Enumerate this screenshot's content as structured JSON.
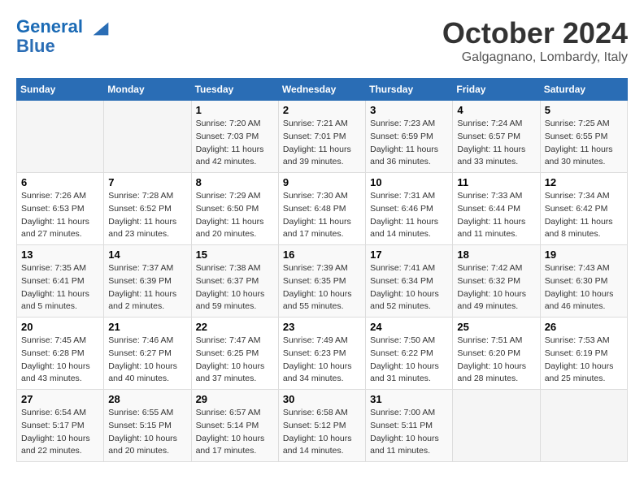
{
  "header": {
    "logo_line1": "General",
    "logo_line2": "Blue",
    "month": "October 2024",
    "location": "Galgagnano, Lombardy, Italy"
  },
  "weekdays": [
    "Sunday",
    "Monday",
    "Tuesday",
    "Wednesday",
    "Thursday",
    "Friday",
    "Saturday"
  ],
  "weeks": [
    [
      {
        "day": "",
        "info": ""
      },
      {
        "day": "",
        "info": ""
      },
      {
        "day": "1",
        "info": "Sunrise: 7:20 AM\nSunset: 7:03 PM\nDaylight: 11 hours and 42 minutes."
      },
      {
        "day": "2",
        "info": "Sunrise: 7:21 AM\nSunset: 7:01 PM\nDaylight: 11 hours and 39 minutes."
      },
      {
        "day": "3",
        "info": "Sunrise: 7:23 AM\nSunset: 6:59 PM\nDaylight: 11 hours and 36 minutes."
      },
      {
        "day": "4",
        "info": "Sunrise: 7:24 AM\nSunset: 6:57 PM\nDaylight: 11 hours and 33 minutes."
      },
      {
        "day": "5",
        "info": "Sunrise: 7:25 AM\nSunset: 6:55 PM\nDaylight: 11 hours and 30 minutes."
      }
    ],
    [
      {
        "day": "6",
        "info": "Sunrise: 7:26 AM\nSunset: 6:53 PM\nDaylight: 11 hours and 27 minutes."
      },
      {
        "day": "7",
        "info": "Sunrise: 7:28 AM\nSunset: 6:52 PM\nDaylight: 11 hours and 23 minutes."
      },
      {
        "day": "8",
        "info": "Sunrise: 7:29 AM\nSunset: 6:50 PM\nDaylight: 11 hours and 20 minutes."
      },
      {
        "day": "9",
        "info": "Sunrise: 7:30 AM\nSunset: 6:48 PM\nDaylight: 11 hours and 17 minutes."
      },
      {
        "day": "10",
        "info": "Sunrise: 7:31 AM\nSunset: 6:46 PM\nDaylight: 11 hours and 14 minutes."
      },
      {
        "day": "11",
        "info": "Sunrise: 7:33 AM\nSunset: 6:44 PM\nDaylight: 11 hours and 11 minutes."
      },
      {
        "day": "12",
        "info": "Sunrise: 7:34 AM\nSunset: 6:42 PM\nDaylight: 11 hours and 8 minutes."
      }
    ],
    [
      {
        "day": "13",
        "info": "Sunrise: 7:35 AM\nSunset: 6:41 PM\nDaylight: 11 hours and 5 minutes."
      },
      {
        "day": "14",
        "info": "Sunrise: 7:37 AM\nSunset: 6:39 PM\nDaylight: 11 hours and 2 minutes."
      },
      {
        "day": "15",
        "info": "Sunrise: 7:38 AM\nSunset: 6:37 PM\nDaylight: 10 hours and 59 minutes."
      },
      {
        "day": "16",
        "info": "Sunrise: 7:39 AM\nSunset: 6:35 PM\nDaylight: 10 hours and 55 minutes."
      },
      {
        "day": "17",
        "info": "Sunrise: 7:41 AM\nSunset: 6:34 PM\nDaylight: 10 hours and 52 minutes."
      },
      {
        "day": "18",
        "info": "Sunrise: 7:42 AM\nSunset: 6:32 PM\nDaylight: 10 hours and 49 minutes."
      },
      {
        "day": "19",
        "info": "Sunrise: 7:43 AM\nSunset: 6:30 PM\nDaylight: 10 hours and 46 minutes."
      }
    ],
    [
      {
        "day": "20",
        "info": "Sunrise: 7:45 AM\nSunset: 6:28 PM\nDaylight: 10 hours and 43 minutes."
      },
      {
        "day": "21",
        "info": "Sunrise: 7:46 AM\nSunset: 6:27 PM\nDaylight: 10 hours and 40 minutes."
      },
      {
        "day": "22",
        "info": "Sunrise: 7:47 AM\nSunset: 6:25 PM\nDaylight: 10 hours and 37 minutes."
      },
      {
        "day": "23",
        "info": "Sunrise: 7:49 AM\nSunset: 6:23 PM\nDaylight: 10 hours and 34 minutes."
      },
      {
        "day": "24",
        "info": "Sunrise: 7:50 AM\nSunset: 6:22 PM\nDaylight: 10 hours and 31 minutes."
      },
      {
        "day": "25",
        "info": "Sunrise: 7:51 AM\nSunset: 6:20 PM\nDaylight: 10 hours and 28 minutes."
      },
      {
        "day": "26",
        "info": "Sunrise: 7:53 AM\nSunset: 6:19 PM\nDaylight: 10 hours and 25 minutes."
      }
    ],
    [
      {
        "day": "27",
        "info": "Sunrise: 6:54 AM\nSunset: 5:17 PM\nDaylight: 10 hours and 22 minutes."
      },
      {
        "day": "28",
        "info": "Sunrise: 6:55 AM\nSunset: 5:15 PM\nDaylight: 10 hours and 20 minutes."
      },
      {
        "day": "29",
        "info": "Sunrise: 6:57 AM\nSunset: 5:14 PM\nDaylight: 10 hours and 17 minutes."
      },
      {
        "day": "30",
        "info": "Sunrise: 6:58 AM\nSunset: 5:12 PM\nDaylight: 10 hours and 14 minutes."
      },
      {
        "day": "31",
        "info": "Sunrise: 7:00 AM\nSunset: 5:11 PM\nDaylight: 10 hours and 11 minutes."
      },
      {
        "day": "",
        "info": ""
      },
      {
        "day": "",
        "info": ""
      }
    ]
  ]
}
